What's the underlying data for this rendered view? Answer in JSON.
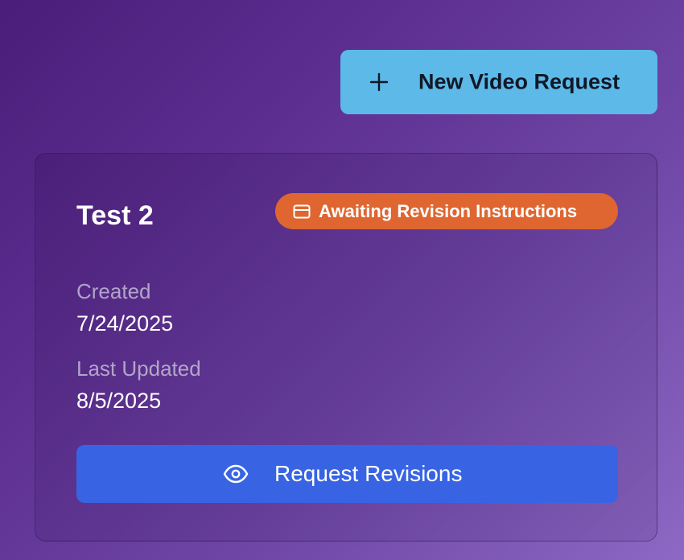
{
  "header": {
    "new_request_label": "New Video Request",
    "new_request_icon": "plus-icon",
    "new_request_color": "#5cb9e8"
  },
  "card": {
    "title": "Test 2",
    "status": {
      "label": "Awaiting Revision Instructions",
      "icon": "card-icon",
      "color": "#df6630"
    },
    "created": {
      "label": "Created",
      "value": "7/24/2025"
    },
    "last_updated": {
      "label": "Last Updated",
      "value": "8/5/2025"
    },
    "action": {
      "label": "Request Revisions",
      "icon": "eye-icon",
      "color": "#3864e4"
    }
  }
}
